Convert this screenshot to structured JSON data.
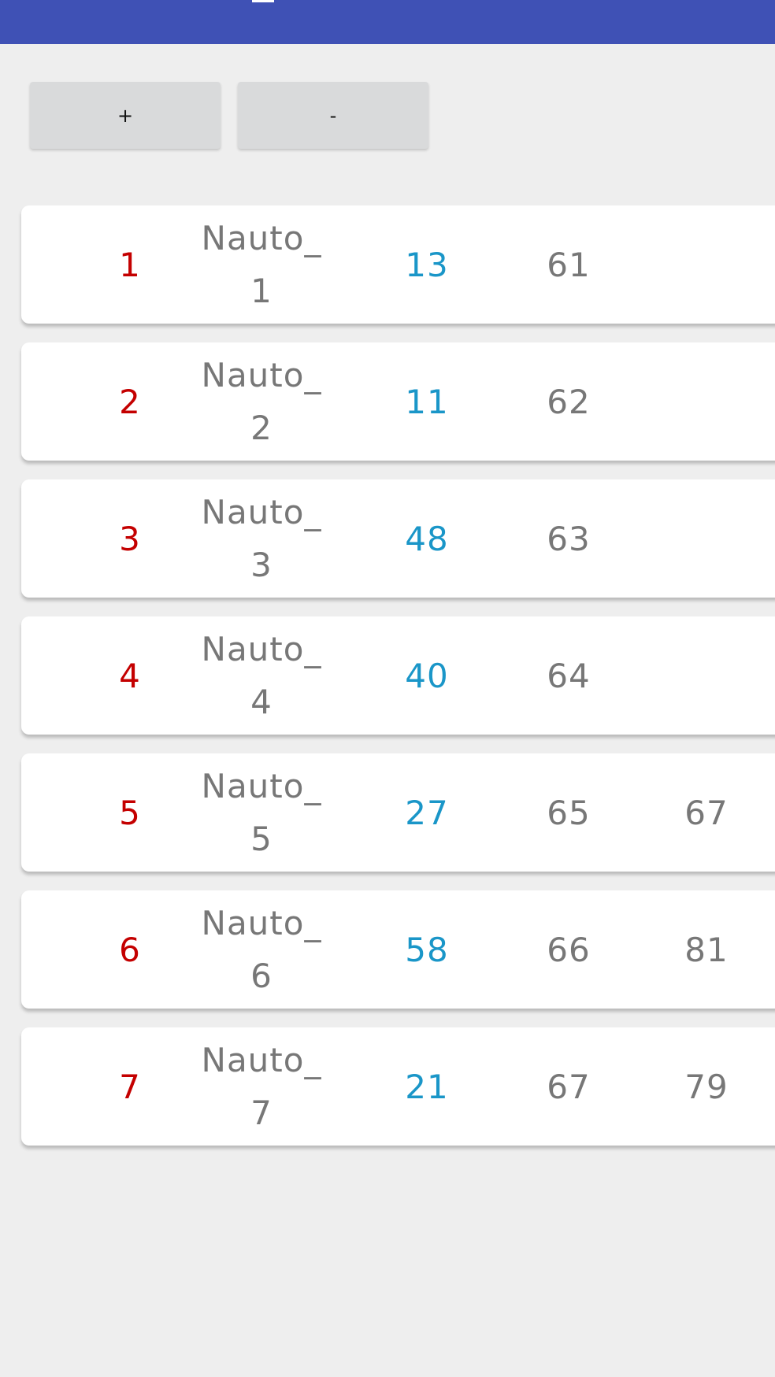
{
  "controls": {
    "plus_label": "+",
    "minus_label": "-"
  },
  "rows": [
    {
      "index": "1",
      "name": "Nauto_\n1",
      "v1": "13",
      "v2": "61",
      "v3": ""
    },
    {
      "index": "2",
      "name": "Nauto_\n2",
      "v1": "11",
      "v2": "62",
      "v3": ""
    },
    {
      "index": "3",
      "name": "Nauto_\n3",
      "v1": "48",
      "v2": "63",
      "v3": ""
    },
    {
      "index": "4",
      "name": "Nauto_\n4",
      "v1": "40",
      "v2": "64",
      "v3": ""
    },
    {
      "index": "5",
      "name": "Nauto_\n5",
      "v1": "27",
      "v2": "65",
      "v3": "67"
    },
    {
      "index": "6",
      "name": "Nauto_\n6",
      "v1": "58",
      "v2": "66",
      "v3": "81"
    },
    {
      "index": "7",
      "name": "Nauto_\n7",
      "v1": "21",
      "v2": "67",
      "v3": "79"
    }
  ],
  "colors": {
    "appbar": "#3f51b5",
    "index_text": "#c40000",
    "value_accent": "#1a96c8",
    "muted_text": "#777777"
  }
}
